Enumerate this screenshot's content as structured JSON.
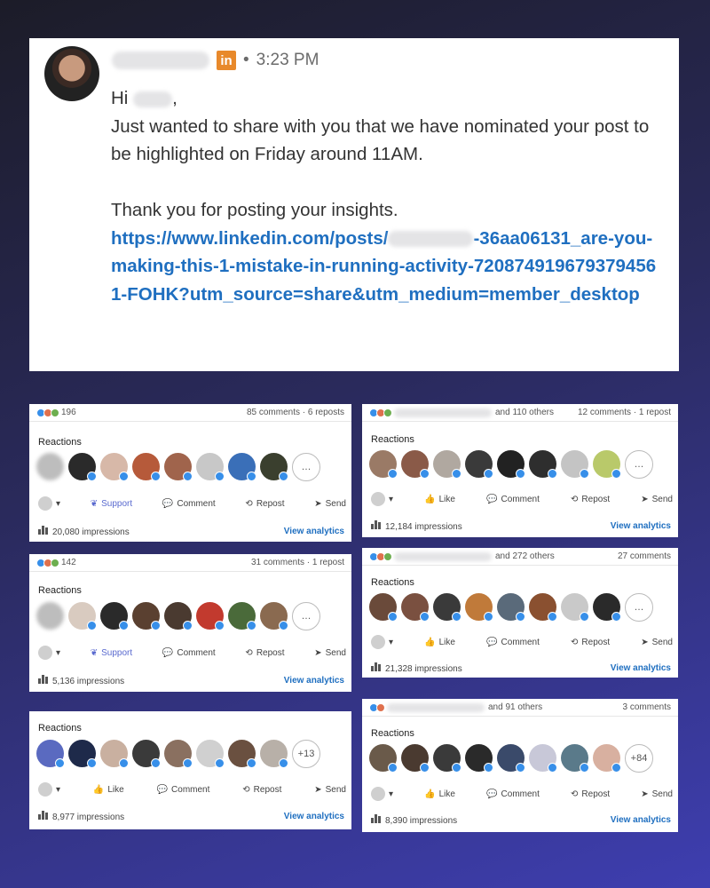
{
  "message": {
    "time": "3:23 PM",
    "separator": "•",
    "li_badge": "in",
    "greeting": "Hi",
    "greeting_end": ",",
    "line1": "Just wanted to share with you that we have nominated your post to be highlighted on Friday around 11AM.",
    "line2": "Thank you for posting your insights.",
    "link_start": "https://www.linkedin.com/posts/",
    "link_end": "-36aa06131_are-you-making-this-1-mistake-in-running-activity-7208749196793794561-FOHK?utm_source=share&utm_medium=member_desktop"
  },
  "labels": {
    "reactions": "Reactions",
    "like": "Like",
    "support": "Support",
    "comment": "Comment",
    "repost": "Repost",
    "send": "Send",
    "view_analytics": "View analytics",
    "more_dots": "…"
  },
  "cards": [
    {
      "count": "196",
      "right": "85 comments · 6 reposts",
      "impressions": "20,080 impressions"
    },
    {
      "count": "and 110 others",
      "right": "12 comments · 1 repost",
      "impressions": "12,184 impressions"
    },
    {
      "count": "142",
      "right": "31 comments · 1 repost",
      "impressions": "5,136 impressions"
    },
    {
      "count": "and 272 others",
      "right": "27 comments",
      "impressions": "21,328 impressions"
    },
    {
      "count": "",
      "right": "",
      "impressions": "8,977 impressions",
      "more": "+13"
    },
    {
      "count": "and 91 others",
      "right": "3 comments",
      "impressions": "8,390 impressions",
      "more": "+84"
    }
  ]
}
